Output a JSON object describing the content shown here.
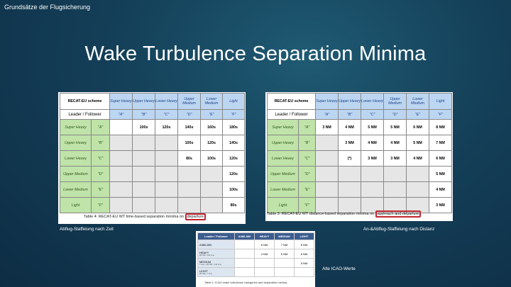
{
  "header": {
    "course": "Grundsätze der Flugsicherung"
  },
  "title": "Wake Turbulence Separation Minima",
  "time_table": {
    "scheme": "RECAT-EU scheme",
    "leader_follower": "Leader / Follower",
    "cats": [
      "Super Heavy",
      "Upper Heavy",
      "Lower Heavy",
      "Upper Medium",
      "Lower Medium",
      "Light"
    ],
    "letters": [
      "\"A\"",
      "\"B\"",
      "\"C\"",
      "\"D\"",
      "\"E\"",
      "\"F\""
    ],
    "rows": [
      {
        "cat": "Super Heavy",
        "letter": "\"A\"",
        "vals": [
          "",
          "100s",
          "120s",
          "140s",
          "160s",
          "180s"
        ]
      },
      {
        "cat": "Upper Heavy",
        "letter": "\"B\"",
        "vals": [
          "",
          "",
          "",
          "100s",
          "120s",
          "140s"
        ]
      },
      {
        "cat": "Lower Heavy",
        "letter": "\"C\"",
        "vals": [
          "",
          "",
          "",
          "80s",
          "100s",
          "120s"
        ]
      },
      {
        "cat": "Upper Medium",
        "letter": "\"D\"",
        "vals": [
          "",
          "",
          "",
          "",
          "",
          "120s"
        ]
      },
      {
        "cat": "Lower Medium",
        "letter": "\"E\"",
        "vals": [
          "",
          "",
          "",
          "",
          "",
          "100s"
        ]
      },
      {
        "cat": "Light",
        "letter": "\"F\"",
        "vals": [
          "",
          "",
          "",
          "",
          "",
          "80s"
        ]
      }
    ],
    "caption_pre": "Table 4: RECAT-EU WT time-based separation minima on",
    "caption_hl": "departure"
  },
  "dist_table": {
    "scheme": "RECAT-EU scheme",
    "leader_follower": "Leader / Follower",
    "cats": [
      "Super Heavy",
      "Upper Heavy",
      "Lower Heavy",
      "Upper Medium",
      "Lower Medium",
      "Light"
    ],
    "letters": [
      "\"A\"",
      "\"B\"",
      "\"C\"",
      "\"D\"",
      "\"E\"",
      "\"F\""
    ],
    "rows": [
      {
        "cat": "Super Heavy",
        "letter": "\"A\"",
        "vals": [
          "3 NM",
          "4 NM",
          "5 NM",
          "5 NM",
          "6 NM",
          "8 NM"
        ]
      },
      {
        "cat": "Upper Heavy",
        "letter": "\"B\"",
        "vals": [
          "",
          "3 NM",
          "4 NM",
          "4 NM",
          "5 NM",
          "7 NM"
        ]
      },
      {
        "cat": "Lower Heavy",
        "letter": "\"C\"",
        "vals": [
          "",
          "(*)",
          "3 NM",
          "3 NM",
          "4 NM",
          "6 NM"
        ]
      },
      {
        "cat": "Upper Medium",
        "letter": "\"D\"",
        "vals": [
          "",
          "",
          "",
          "",
          "",
          "5 NM"
        ]
      },
      {
        "cat": "Lower Medium",
        "letter": "\"E\"",
        "vals": [
          "",
          "",
          "",
          "",
          "",
          "4 NM"
        ]
      },
      {
        "cat": "Light",
        "letter": "\"F\"",
        "vals": [
          "",
          "",
          "",
          "",
          "",
          "3 NM"
        ]
      }
    ],
    "caption_pre": "Table 3: RECAT-EU WT distance-based separation minima on",
    "caption_hl": "approach and departure"
  },
  "icao_table": {
    "head": [
      "Leader / Follower",
      "A380-800",
      "HEAVY",
      "MEDIUM",
      "LIGHT"
    ],
    "rows": [
      {
        "name": "A380-800",
        "sub": "",
        "vals": [
          "",
          "6 NM",
          "7 NM",
          "8 NM"
        ]
      },
      {
        "name": "HEAVY",
        "sub": "MTOM ≥ 136 tons",
        "vals": [
          "",
          "4 NM",
          "5 NM",
          "6 NM"
        ]
      },
      {
        "name": "MEDIUM",
        "sub": "7 tons < MTOM < 136 tons",
        "vals": [
          "",
          "",
          "",
          "5 NM"
        ]
      },
      {
        "name": "LIGHT",
        "sub": "MTOM ≤ 7 tons",
        "vals": [
          "",
          "",
          "",
          ""
        ]
      }
    ],
    "caption": "Table 1: ICAO wake turbulence categories and separation minima"
  },
  "notes": {
    "time": "Abflug-Staffelung nach Zeit",
    "distance": "An-&Abflug-Staffelung nach Distanz",
    "icao": "Alte ICAO-Werte"
  }
}
